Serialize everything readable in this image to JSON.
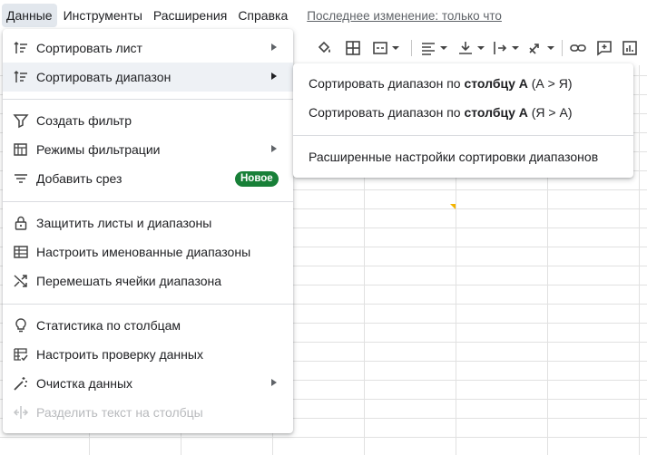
{
  "menubar": {
    "items": [
      "Данные",
      "Инструменты",
      "Расширения",
      "Справка"
    ],
    "last_edit": "Последнее изменение: только что"
  },
  "data_menu": {
    "sort_sheet": "Сортировать лист",
    "sort_range": "Сортировать диапазон",
    "create_filter": "Создать фильтр",
    "filter_views": "Режимы фильтрации",
    "add_slicer": "Добавить срез",
    "new_badge": "Новое",
    "protect": "Защитить листы и диапазоны",
    "named_ranges": "Настроить именованные диапазоны",
    "randomize": "Перемешать ячейки диапазона",
    "column_stats": "Статистика по столбцам",
    "data_validation": "Настроить проверку данных",
    "data_cleanup": "Очистка данных",
    "split_text": "Разделить текст на столбцы"
  },
  "submenu": {
    "sort_az_prefix": "Сортировать диапазон по ",
    "sort_az_bold": "столбцу A",
    "sort_az_suffix": " (А > Я)",
    "sort_za_prefix": "Сортировать диапазон по ",
    "sort_za_bold": "столбцу A",
    "sort_za_suffix": " (Я > А)",
    "advanced": "Расширенные настройки сортировки диапазонов"
  },
  "icons": {
    "sort": "sort-icon",
    "filter": "filter-icon",
    "filter_views": "filter-views-icon",
    "slicer": "slicer-icon",
    "lock": "lock-icon",
    "named_ranges": "named-ranges-icon",
    "shuffle": "shuffle-icon",
    "stats": "lightbulb-icon",
    "validation": "validation-icon",
    "cleanup": "magic-wand-icon",
    "split": "split-icon"
  },
  "colors": {
    "badge": "#188038",
    "menu_hover": "#eef1f5",
    "active_menu": "#e2e7ed",
    "indicator": "#f4b400"
  }
}
